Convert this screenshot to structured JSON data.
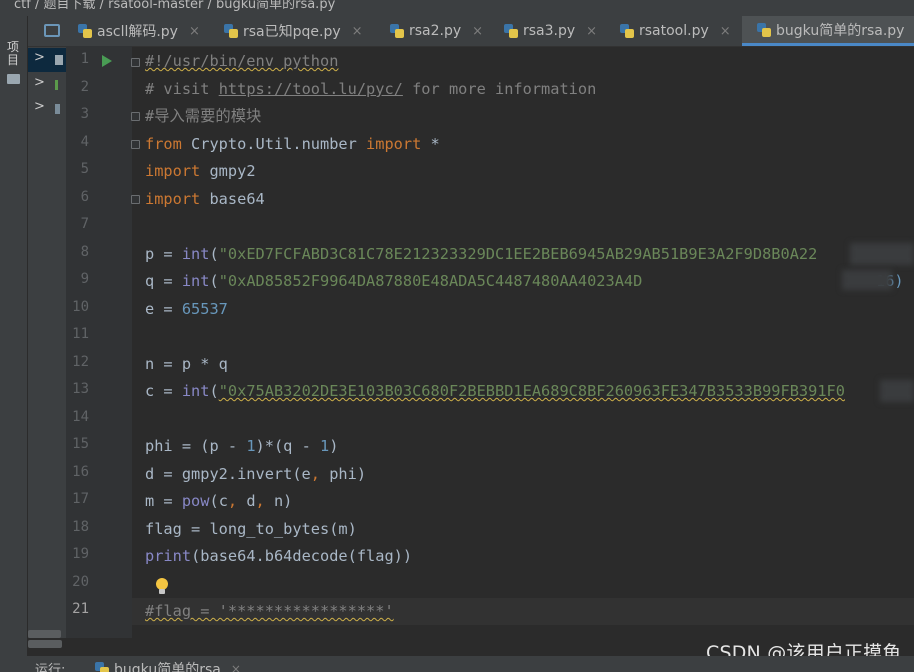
{
  "breadcrumb": {
    "text": "ctf / 题目下载 / rsatool-master / bugku简单的rsa.py"
  },
  "sidebar": {
    "project_label": "项目"
  },
  "tabs": [
    {
      "label": "ascll解码.py",
      "active": false
    },
    {
      "label": "rsa已知pqe.py",
      "active": false
    },
    {
      "label": "rsa2.py",
      "active": false
    },
    {
      "label": "rsa3.py",
      "active": false
    },
    {
      "label": "rsatool.py",
      "active": false
    },
    {
      "label": "bugku简单的rsa.py",
      "active": true
    }
  ],
  "close_glyph": "×",
  "editor": {
    "line_numbers": [
      "1",
      "2",
      "3",
      "4",
      "5",
      "6",
      "7",
      "8",
      "9",
      "10",
      "11",
      "12",
      "13",
      "14",
      "15",
      "16",
      "17",
      "18",
      "19",
      "20",
      "21"
    ],
    "current_line": "21",
    "l1": "#!/usr/bin/env python",
    "l2_prefix": "# visit ",
    "l2_url": "https://tool.lu/pyc/",
    "l2_suffix": " for more information",
    "l3": "#导入需要的模块",
    "l4_kw": "from",
    "l4_mod": " Crypto.Util.number ",
    "l4_kw2": "import",
    "l4_star": " *",
    "l5_kw": "import",
    "l5_mod": " gmpy2",
    "l6_kw": "import",
    "l6_mod": " base64",
    "l8_var": "p = ",
    "l8_fn": "int",
    "l8_open": "(",
    "l8_str": "\"0xED7FCFABD3C81C78E212323329DC1EE2BEB6945AB29AB51B9E3A2F9D8B0A22",
    "l9_var": "q = ",
    "l9_fn": "int",
    "l9_open": "(",
    "l9_str": "\"0xAD85852F9964DA87880E48ADA5C4487480AA4023A4D",
    "l9_tail": "16)",
    "l10_var": "e = ",
    "l10_num": "65537",
    "l12": "n = p * q",
    "l13_var": "c = ",
    "l13_fn": "int",
    "l13_open": "(",
    "l13_str": "\"0x75AB3202DE3E103B03C680F2BEBBD1EA689C8BF260963FE347B3533B99FB391F0",
    "l15_a": "phi = (p - ",
    "l15_n1": "1",
    "l15_b": ")*(q - ",
    "l15_n2": "1",
    "l15_c": ")",
    "l16_a": "d = gmpy2.invert(e",
    "l16_comma": ",",
    "l16_b": " phi)",
    "l17_a": "m = ",
    "l17_fn": "pow",
    "l17_b": "(c",
    "l17_c1": ",",
    "l17_d": " d",
    "l17_c2": ",",
    "l17_e": " n)",
    "l18": "flag = long_to_bytes(m)",
    "l19_fn": "print",
    "l19_rest": "(base64.b64decode(flag))",
    "l21": "#flag = '*****************'"
  },
  "bottom": {
    "run_label": "运行:",
    "run_tab": "bugku简单的rsa"
  },
  "watermark": "CSDN @该用户正摸鱼",
  "colors": {
    "background": "#2b2b2b",
    "keyword": "#cc7832",
    "string": "#6a8759",
    "number": "#6897bb",
    "comment": "#808080",
    "builtin": "#8888c6",
    "accent": "#4a88c7"
  }
}
